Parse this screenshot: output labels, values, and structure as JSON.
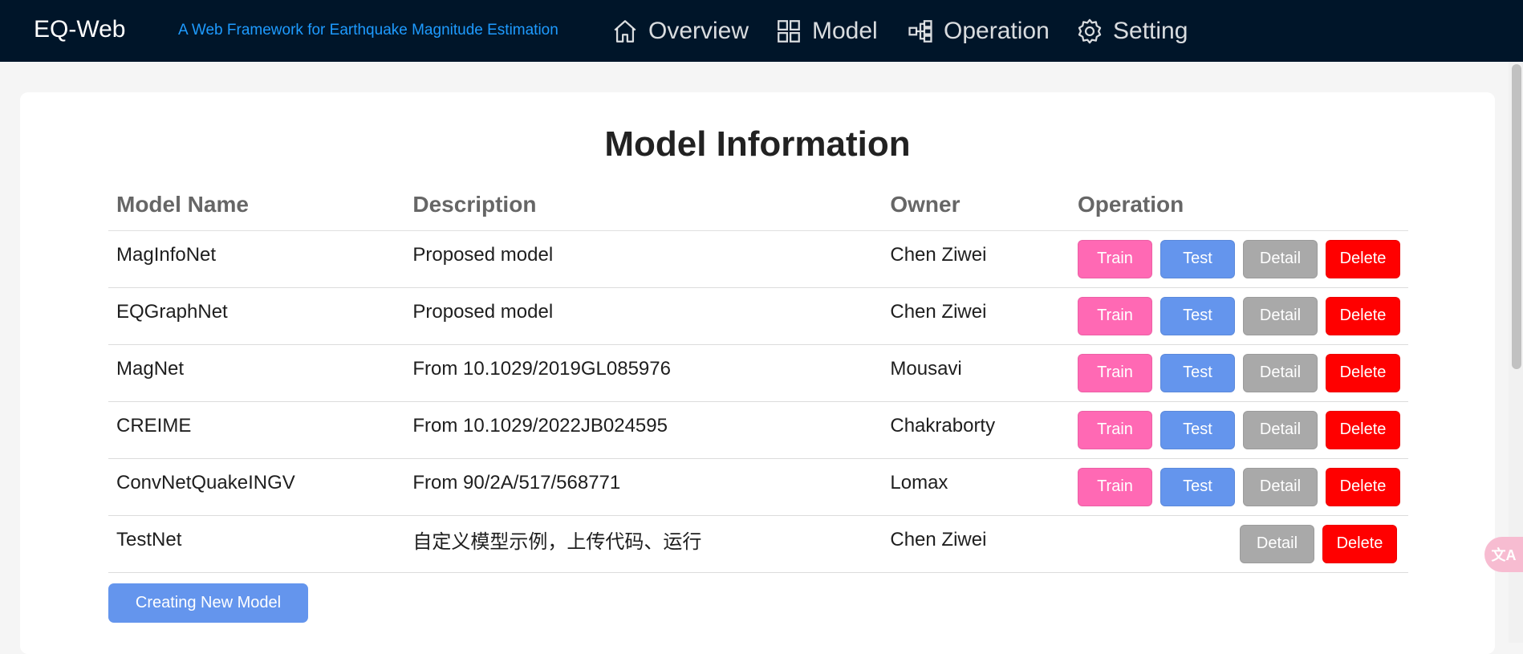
{
  "header": {
    "brand": "EQ-Web",
    "subtitle": "A Web Framework for Earthquake Magnitude Estimation",
    "nav": [
      {
        "label": "Overview",
        "icon": "home-icon"
      },
      {
        "label": "Model",
        "icon": "grid-icon"
      },
      {
        "label": "Operation",
        "icon": "workflow-icon"
      },
      {
        "label": "Setting",
        "icon": "gear-icon"
      }
    ]
  },
  "main": {
    "title": "Model Information",
    "columns": [
      "Model Name",
      "Description",
      "Owner",
      "Operation"
    ],
    "buttons": {
      "train": "Train",
      "test": "Test",
      "detail": "Detail",
      "delete": "Delete"
    },
    "rows": [
      {
        "name": "MagInfoNet",
        "description": "Proposed model",
        "owner": "Chen Ziwei",
        "actions": [
          "train",
          "test",
          "detail",
          "delete"
        ]
      },
      {
        "name": "EQGraphNet",
        "description": "Proposed model",
        "owner": "Chen Ziwei",
        "actions": [
          "train",
          "test",
          "detail",
          "delete"
        ]
      },
      {
        "name": "MagNet",
        "description": "From 10.1029/2019GL085976",
        "owner": "Mousavi",
        "actions": [
          "train",
          "test",
          "detail",
          "delete"
        ]
      },
      {
        "name": "CREIME",
        "description": "From 10.1029/2022JB024595",
        "owner": "Chakraborty",
        "actions": [
          "train",
          "test",
          "detail",
          "delete"
        ]
      },
      {
        "name": "ConvNetQuakeINGV",
        "description": "From 90/2A/517/568771",
        "owner": "Lomax",
        "actions": [
          "train",
          "test",
          "detail",
          "delete"
        ]
      },
      {
        "name": "TestNet",
        "description": "自定义模型示例，上传代码、运行",
        "owner": "Chen Ziwei",
        "actions": [
          "detail",
          "delete"
        ]
      }
    ],
    "create_button": "Creating New Model"
  },
  "translate_widget": {
    "icon": "translate-icon",
    "glyph": "文A"
  },
  "colors": {
    "header_bg": "#001529",
    "subtitle": "#1e9bff",
    "train": "#ff69b4",
    "test": "#6495ed",
    "detail": "#a9a9a9",
    "delete": "#ff0000"
  }
}
